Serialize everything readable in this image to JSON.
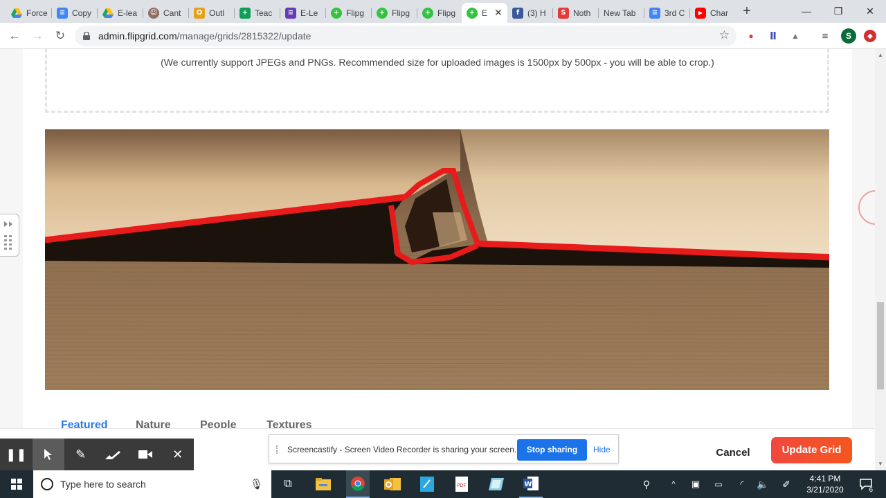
{
  "browser": {
    "tabs": [
      {
        "label": "Force",
        "fav_icon": "google-drive-icon",
        "fav_color": "#1fa463",
        "active": false
      },
      {
        "label": "Copy",
        "fav_icon": "google-docs-icon",
        "fav_color": "#4285f4",
        "active": false
      },
      {
        "label": "E-lea",
        "fav_icon": "google-drive-icon",
        "fav_color": "#1fa463",
        "active": false
      },
      {
        "label": "Cant",
        "fav_icon": "person-icon",
        "fav_color": "#8d6e63",
        "active": false
      },
      {
        "label": "Outl",
        "fav_icon": "outlook-icon",
        "fav_color": "#e6a117",
        "active": false
      },
      {
        "label": "Teac",
        "fav_icon": "google-sheets-icon",
        "fav_color": "#0f9d58",
        "active": false
      },
      {
        "label": "E-Le",
        "fav_icon": "google-forms-icon",
        "fav_color": "#673ab7",
        "active": false
      },
      {
        "label": "Flipg",
        "fav_icon": "flipgrid-icon",
        "fav_color": "#34c240",
        "active": false
      },
      {
        "label": "Flipg",
        "fav_icon": "flipgrid-icon",
        "fav_color": "#34c240",
        "active": false
      },
      {
        "label": "Flipg",
        "fav_icon": "flipgrid-icon",
        "fav_color": "#34c240",
        "active": false
      },
      {
        "label": "E",
        "fav_icon": "flipgrid-icon",
        "fav_color": "#34c240",
        "active": true
      },
      {
        "label": "(3) H",
        "fav_icon": "facebook-icon",
        "fav_color": "#3b5998",
        "active": false
      },
      {
        "label": "Noth",
        "fav_icon": "s-icon",
        "fav_color": "#e53935",
        "active": false
      },
      {
        "label": "New Tab",
        "fav_icon": "",
        "fav_color": "",
        "active": false
      },
      {
        "label": "3rd C",
        "fav_icon": "google-docs-icon",
        "fav_color": "#4285f4",
        "active": false
      },
      {
        "label": "Char",
        "fav_icon": "youtube-icon",
        "fav_color": "#ff0000",
        "active": false
      }
    ],
    "new_tab_symbol": "+",
    "url_domain": "admin.flipgrid.com",
    "url_path": "/manage/grids/2815322/update",
    "profile_initial": "S"
  },
  "page": {
    "upload_hint": "(We currently support JPEGs and PNGs. Recommended size for uploaded images is 1500px by 500px - you will be able to crop.)",
    "categories": [
      "Featured",
      "Nature",
      "People",
      "Textures"
    ],
    "active_category": "Featured",
    "cancel_label": "Cancel",
    "update_label": "Update Grid"
  },
  "screencastify": {
    "share_message": "Screencastify - Screen Video Recorder is sharing your screen.",
    "stop_label": "Stop sharing",
    "hide_label": "Hide"
  },
  "taskbar": {
    "search_placeholder": "Type here to search",
    "time": "4:41 PM",
    "date": "3/21/2020",
    "notification_count": "6"
  },
  "colors": {
    "accent": "#2a7ae2",
    "update_button": "#f0483e",
    "stop_button": "#1a73e8"
  }
}
